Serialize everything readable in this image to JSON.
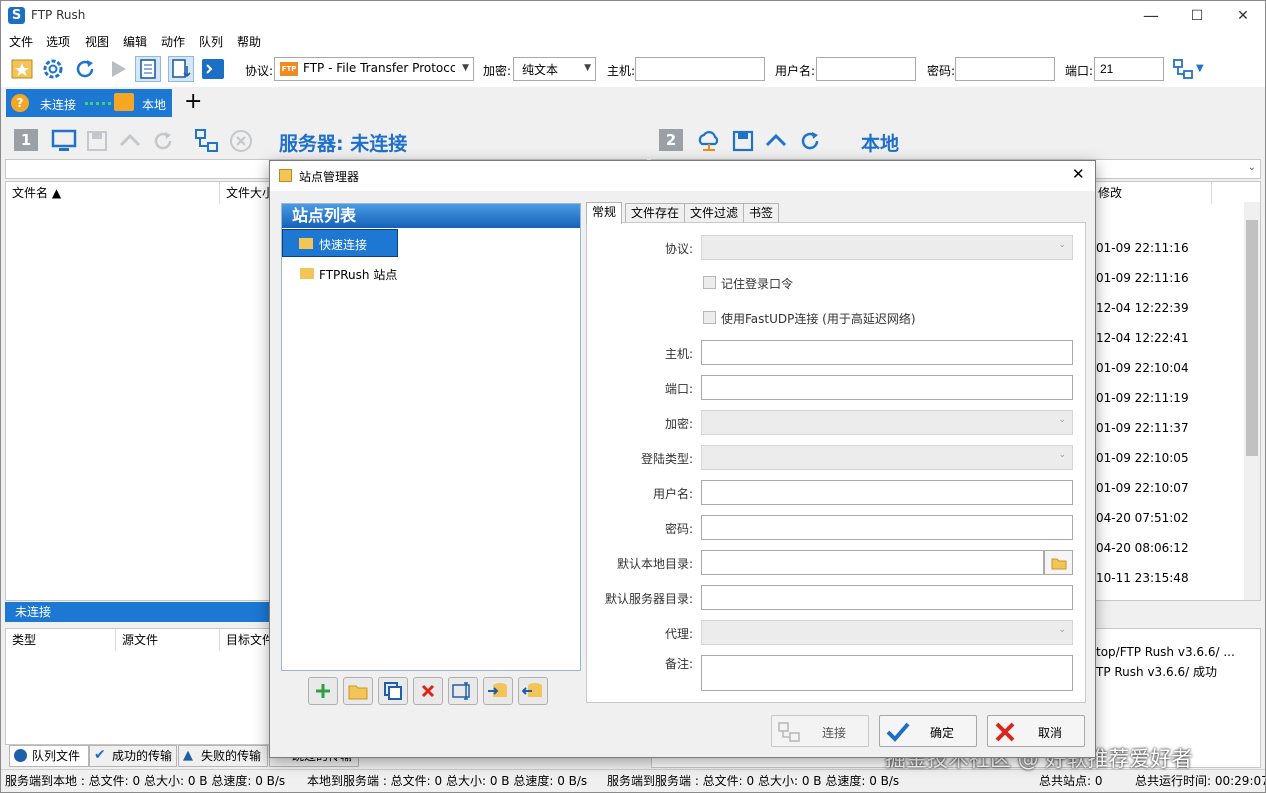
{
  "window": {
    "title": "FTP Rush",
    "min": "—",
    "max": "☐",
    "close": "✕"
  },
  "menu": [
    "文件",
    "选项",
    "视图",
    "编辑",
    "动作",
    "队列",
    "帮助"
  ],
  "toolbar": {
    "protocol_label": "协议:",
    "protocol_value": "FTP - File Transfer Protocc",
    "protocol_badge": "FTP",
    "encrypt_label": "加密:",
    "encrypt_value": "纯文本",
    "host_label": "主机:",
    "user_label": "用户名:",
    "pass_label": "密码:",
    "port_label": "端口:",
    "port_value": "21"
  },
  "conn_tab": {
    "status": "未连接",
    "local": "本地",
    "add": "+"
  },
  "left_panel": {
    "num": "1",
    "title": "服务器:  未连接",
    "col_name": "文件名 ▲",
    "col_size": "文件大小",
    "status": "未连接"
  },
  "right_panel": {
    "num": "2",
    "title": "本地",
    "col_modified": "修改",
    "dates": [
      "01-09 22:11:16",
      "01-09 22:11:16",
      "12-04 12:22:39",
      "12-04 12:22:41",
      "01-09 22:10:04",
      "01-09 22:11:19",
      "01-09 22:11:37",
      "01-09 22:10:05",
      "01-09 22:10:07",
      "04-20 07:51:02",
      "04-20 08:06:12",
      "10-11 23:15:48"
    ],
    "log": [
      "top/FTP Rush v3.6.6/ ...",
      "TP Rush v3.6.6/ 成功"
    ]
  },
  "queue": {
    "col_type": "类型",
    "col_src": "源文件",
    "col_dst": "目标文件"
  },
  "bottom_tabs": [
    "队列文件",
    "成功的传输",
    "失败的传输",
    "跳过的传输"
  ],
  "status": {
    "s1": "服务端到本地 : 总文件: 0  总大小: 0 B  总速度: 0 B/s",
    "s2": "本地到服务端 : 总文件: 0  总大小: 0 B  总速度: 0 B/s",
    "s3": "服务端到服务端 : 总文件: 0  总大小: 0 B  总速度: 0 B/s",
    "s4": "总共站点: 0",
    "s5": "总共运行时间: 00:29:07"
  },
  "watermark": "掘金技术社区 @ 好软推荐爱好者",
  "dialog": {
    "title": "站点管理器",
    "list_header": "站点列表",
    "sites": [
      "快速连接",
      "FTPRush 站点"
    ],
    "tabs": [
      "常规",
      "文件存在",
      "文件过滤",
      "书签"
    ],
    "labels": {
      "protocol": "协议:",
      "remember": "记住登录口令",
      "fastudp": "使用FastUDP连接 (用于高延迟网络)",
      "host": "主机:",
      "port": "端口:",
      "encrypt": "加密:",
      "login_type": "登陆类型:",
      "user": "用户名:",
      "password": "密码:",
      "local_dir": "默认本地目录:",
      "server_dir": "默认服务器目录:",
      "proxy": "代理:",
      "note": "备注:"
    },
    "buttons": {
      "connect": "连接",
      "ok": "确定",
      "cancel": "取消"
    },
    "colors": {
      "accent": "#1d78d4",
      "ok_check": "#1d6fc4",
      "cancel_x": "#d9261c"
    }
  }
}
